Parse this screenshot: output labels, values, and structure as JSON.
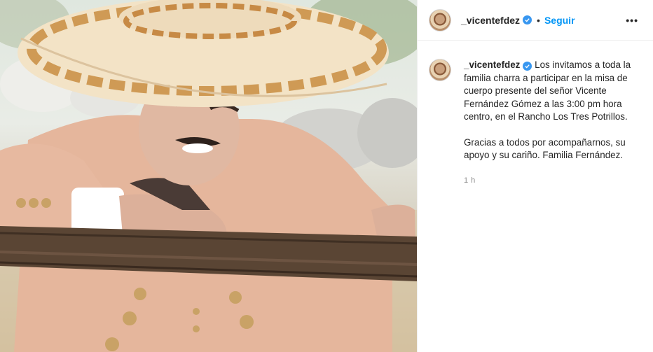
{
  "post": {
    "username": "_vicentefdez",
    "follow_label": "Seguir",
    "separator": "•",
    "more_label": "•••",
    "caption_paragraph_1": "Los invitamos a toda la familia charra a participar en la misa de cuerpo presente del señor Vicente Fernández Gómez a las 3:00 pm hora centro, en el Rancho Los Tres Potrillos.",
    "caption_paragraph_2": "Gracias a todos por acompañarnos, su apoyo y su cariño. Familia Fernández.",
    "timestamp": "1 h"
  },
  "icons": {
    "verified": "verified-badge-icon",
    "more": "more-options-icon"
  },
  "colors": {
    "follow": "#0095f6",
    "verified": "#3897f0",
    "text": "#262626",
    "muted": "#8e8e8e"
  }
}
